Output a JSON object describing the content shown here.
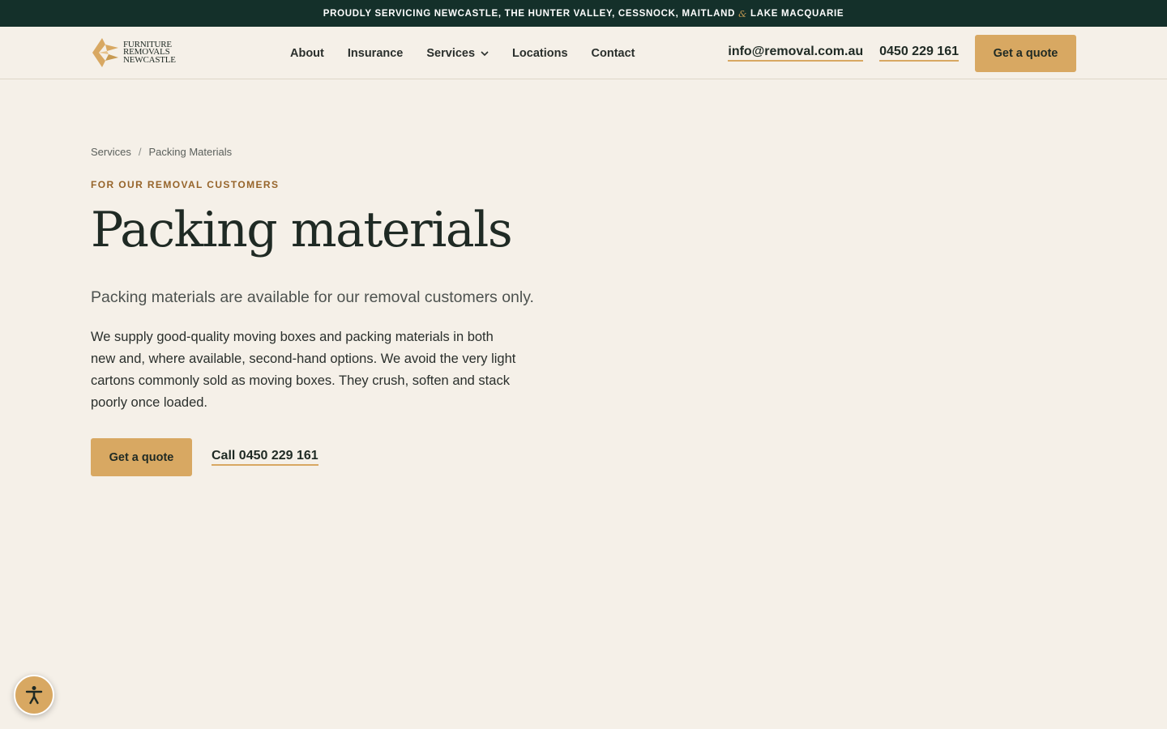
{
  "topbar": {
    "text_before": "PROUDLY SERVICING NEWCASTLE, THE HUNTER VALLEY, CESSNOCK, MAITLAND",
    "ampersand": "&",
    "text_after": "LAKE MACQUARIE"
  },
  "logo": {
    "line1": "FURNITURE",
    "line2": "REMOVALS",
    "line3": "NEWCASTLE",
    "icon": "logo-mark"
  },
  "nav": {
    "items": [
      {
        "label": "About"
      },
      {
        "label": "Insurance"
      },
      {
        "label": "Services",
        "icon": "chevron-down-icon"
      },
      {
        "label": "Locations"
      },
      {
        "label": "Contact"
      }
    ]
  },
  "header": {
    "email": "info@removal.com.au",
    "phone": "0450 229 161",
    "quote_button": "Get a quote"
  },
  "breadcrumb": {
    "items": [
      "Services",
      "Packing Materials"
    ],
    "separator": "/"
  },
  "hero": {
    "eyebrow": "FOR OUR REMOVAL CUSTOMERS",
    "title": "Packing materials",
    "lead": "Packing materials are available for our removal customers only.",
    "body": "We supply good-quality moving boxes and packing materials in both new and, where available, second-hand options. We avoid the very light cartons commonly sold as moving boxes. They crush, soften and stack poorly once loaded.",
    "cta_button": "Get a quote",
    "call_link": "Call 0450 229 161"
  },
  "accessibility": {
    "icon": "accessibility-icon"
  },
  "colors": {
    "topbar_bg": "#14302a",
    "page_bg": "#f5f0e8",
    "accent": "#d8a862",
    "eyebrow": "#96642a",
    "text": "#1f2a24"
  }
}
